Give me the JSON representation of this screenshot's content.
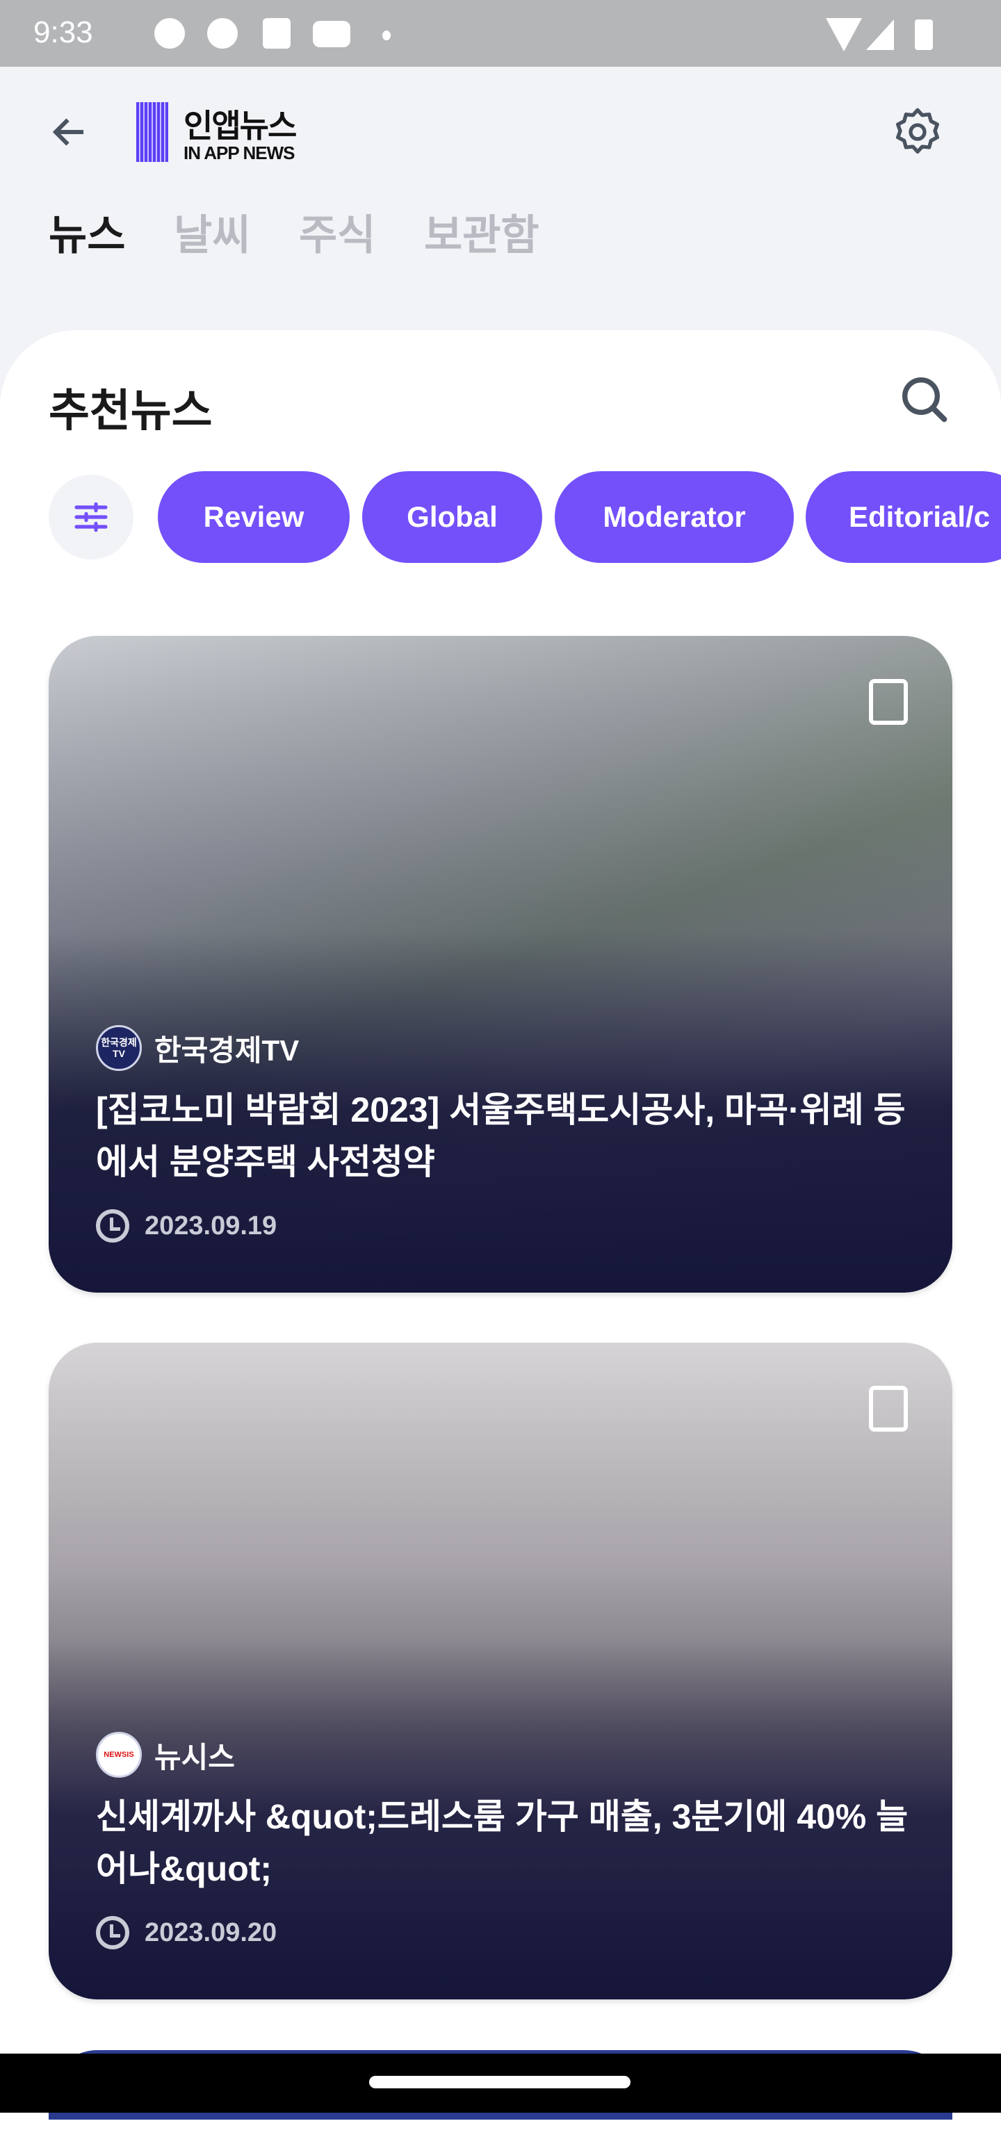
{
  "status_bar": {
    "time": "9:33",
    "notification_icons": [
      "messenger-icon",
      "kakaotalk-icon",
      "shopping-icon",
      "youtube-icon",
      "dot-icon"
    ],
    "system_icons": [
      "wifi-icon",
      "signal-icon",
      "battery-icon"
    ]
  },
  "header": {
    "logo_korean": "인앱뉴스",
    "logo_english": "IN APP NEWS",
    "back_icon": "arrow-left-icon",
    "settings_icon": "gear-icon"
  },
  "tabs": [
    {
      "label": "뉴스",
      "active": true
    },
    {
      "label": "날씨",
      "active": false
    },
    {
      "label": "주식",
      "active": false
    },
    {
      "label": "보관함",
      "active": false
    }
  ],
  "section": {
    "title": "추천뉴스",
    "search_icon": "search-icon"
  },
  "chips": [
    "Review",
    "Global",
    "Moderator",
    "Editorial/c"
  ],
  "colors": {
    "accent": "#7350fa",
    "background": "#f2f3f7"
  },
  "articles": [
    {
      "source": "한국경제TV",
      "source_logo": "한국경제 TV",
      "title": "[집코노미 박람회 2023] 서울주택도시공사, 마곡·위례 등에서 분양주택 사전청약",
      "date": "2023.09.19"
    },
    {
      "source": "뉴시스",
      "source_logo": "NEWSIS",
      "title": "신세계까사 &quot;드레스룸 가구 매출, 3분기에 40% 늘어나&quot;",
      "date": "2023.09.20"
    }
  ]
}
